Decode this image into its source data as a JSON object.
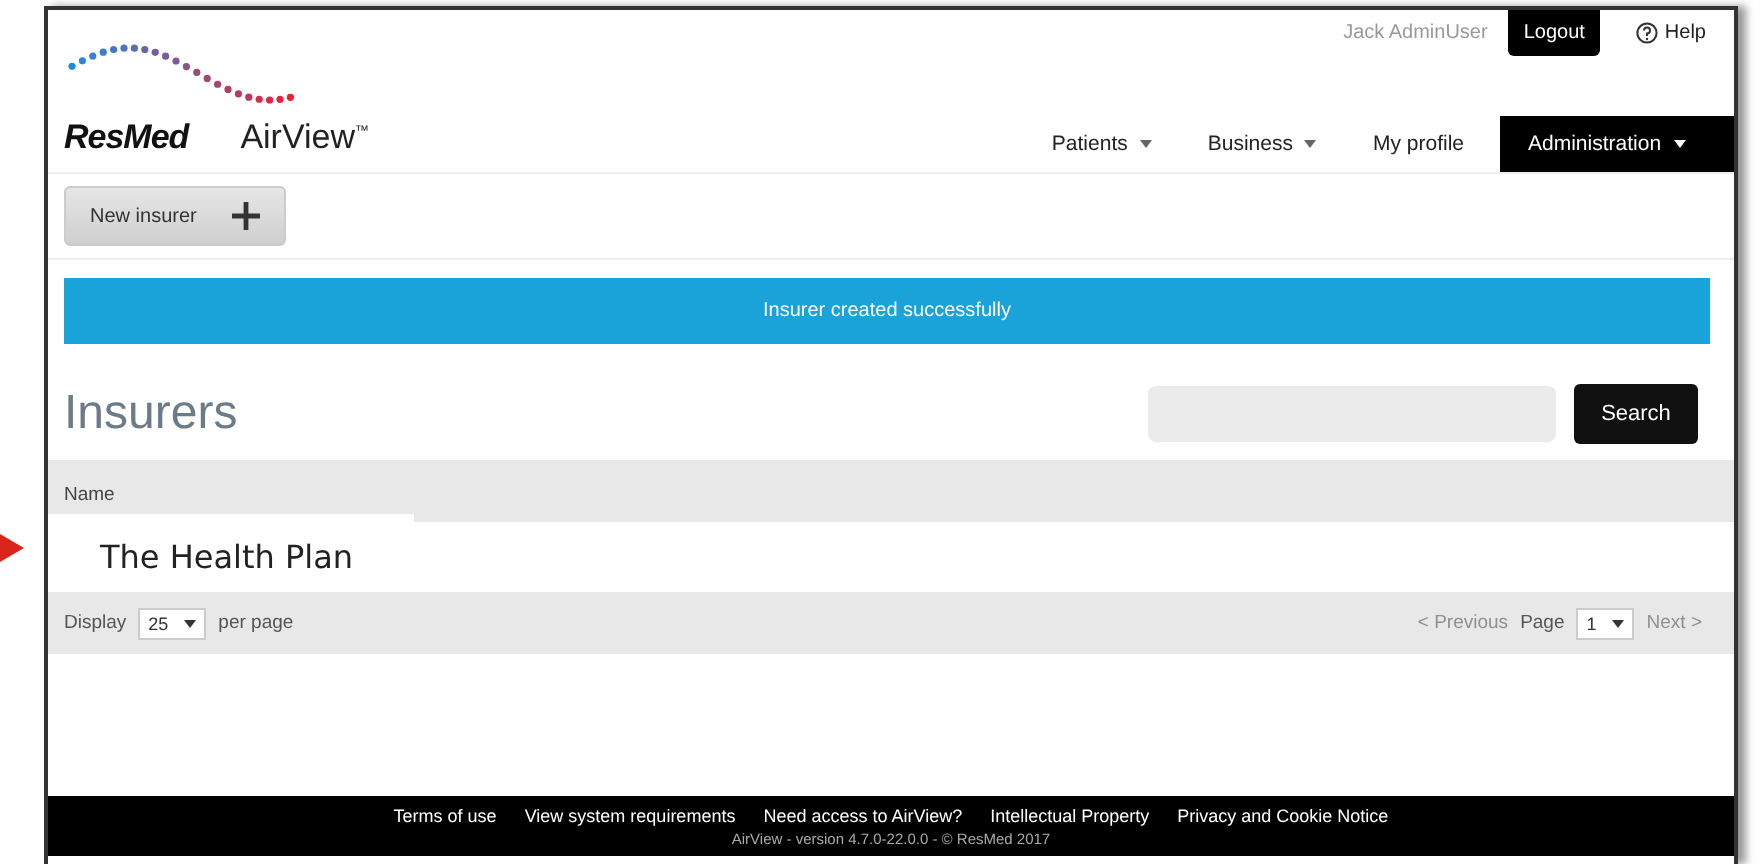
{
  "header": {
    "brand": "ResMed",
    "product": "AirView",
    "trademark": "™",
    "user": "Jack AdminUser",
    "logout": "Logout",
    "help": "Help"
  },
  "nav": [
    {
      "label": "Patients",
      "dropdown": true,
      "selected": false
    },
    {
      "label": "Business",
      "dropdown": true,
      "selected": false
    },
    {
      "label": "My profile",
      "dropdown": false,
      "selected": false
    },
    {
      "label": "Administration",
      "dropdown": true,
      "selected": true
    }
  ],
  "toolbar": {
    "new_button": "New insurer"
  },
  "banner": "Insurer created successfully",
  "title": "Insurers",
  "search": {
    "button": "Search"
  },
  "table": {
    "columns": [
      "Name"
    ],
    "rows": [
      {
        "name": "The Health Plan",
        "highlighted": true
      }
    ]
  },
  "pagination": {
    "display_label": "Display",
    "page_size": "25",
    "per_page": "per page",
    "previous": {
      "label": "< Previous",
      "disabled": true
    },
    "page_label": "Page",
    "page": "1",
    "next": {
      "label": "Next >",
      "disabled": true
    }
  },
  "footer": {
    "links": [
      "Terms of use",
      "View system requirements",
      "Need access to AirView?",
      "Intellectual Property",
      "Privacy and Cookie Notice"
    ],
    "version": "AirView - version 4.7.0-22.0.0  - © ResMed 2017"
  }
}
